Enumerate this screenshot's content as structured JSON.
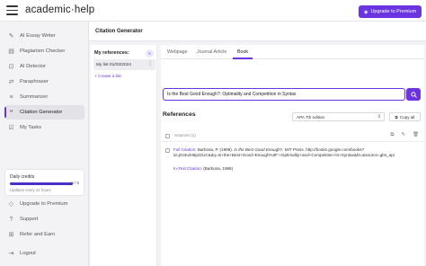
{
  "header": {
    "brand_prefix": "academic",
    "brand_sep": "·",
    "brand_suffix": "help",
    "upgrade_label": "Upgrade to Premium"
  },
  "sidebar": {
    "items": [
      {
        "label": "AI Essay Writer",
        "icon": "pencil-icon"
      },
      {
        "label": "Plagiarism Checker",
        "icon": "document-check-icon"
      },
      {
        "label": "AI Detector",
        "icon": "ai-detect-icon"
      },
      {
        "label": "Paraphraser",
        "icon": "paraphrase-icon"
      },
      {
        "label": "Summarizer",
        "icon": "summarize-icon"
      },
      {
        "label": "Citation Generator",
        "icon": "quote-icon"
      },
      {
        "label": "My Tasks",
        "icon": "tasks-icon"
      }
    ],
    "credits": {
      "title": "Daily credits",
      "count": "5 / 5",
      "fraction": 1.0,
      "subtitle": "Updates every 24 hours"
    },
    "bottom": [
      {
        "label": "Upgrade to Premium",
        "icon": "diamond-icon"
      },
      {
        "label": "Support",
        "icon": "help-icon"
      },
      {
        "label": "Refer and Earn",
        "icon": "gift-icon"
      },
      {
        "label": "Logout",
        "icon": "logout-icon"
      }
    ]
  },
  "main": {
    "title": "Citation Generator",
    "refs_panel": {
      "title": "My references:",
      "collapse_icon": "double-chevron-left-icon",
      "list_name": "My list 01/03/2024",
      "create_label": "+ Create a list"
    },
    "tabs": [
      "Webpage",
      "Journal Article",
      "Book"
    ],
    "active_tab": "Book",
    "search_value": "Is the Best Good Enough?: Optimality and Competition in Syntax",
    "references_title": "References",
    "style_value": "APA 7th edition",
    "copy_all_label": "Copy all",
    "sources_label": "Sources (1)",
    "citation": {
      "full_label": "Full Citation:",
      "full_pre": "Barbosa, P. (1998).",
      "full_title": "Is the Best Good Enough?.",
      "full_post": "MIT Press. http://books.google.com/books?id=jKeKdH8pZzUC&dq=Is+the+Best+Good+Enough%3F:+Optimality+and+Competition+in+Syntax&hl=&source=gbs_api",
      "intext_label": "In-Text Citation:",
      "intext_value": "(Barbosa, 1998)"
    }
  },
  "colors": {
    "accent": "#6a35e0",
    "background": "#f3f3f5"
  }
}
